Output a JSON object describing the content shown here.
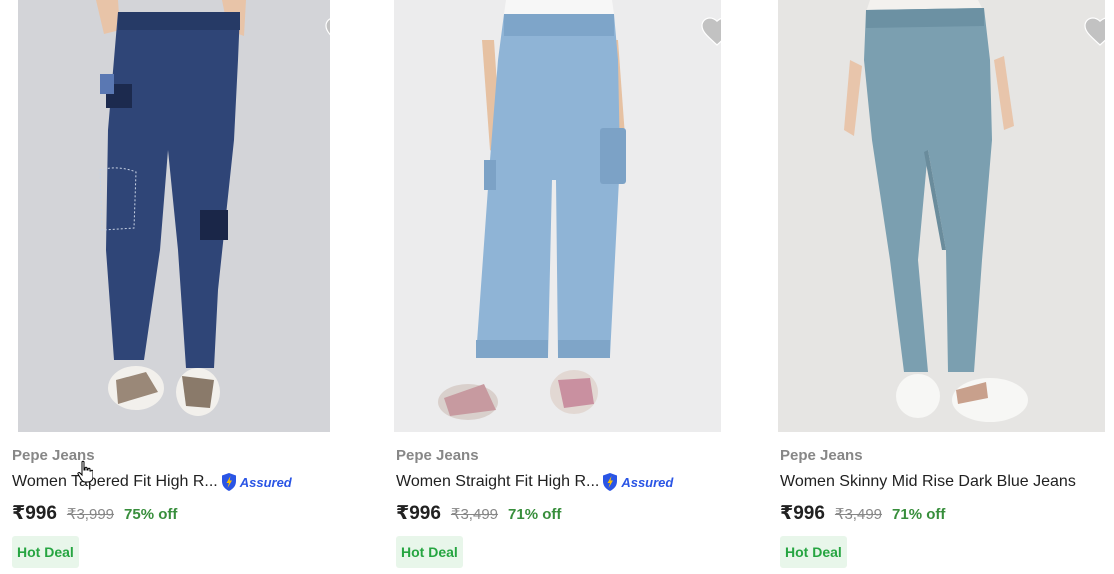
{
  "products": [
    {
      "brand": "Pepe Jeans",
      "title": "Women Tapered Fit High R...",
      "assured": true,
      "assured_label": "Assured",
      "price": "₹996",
      "mrp": "₹3,999",
      "discount": "75% off",
      "deal": "Hot Deal",
      "image_icon": "jeans-dark-blue-patched",
      "wishlisted": false
    },
    {
      "brand": "Pepe Jeans",
      "title": "Women Straight Fit High R...",
      "assured": true,
      "assured_label": "Assured",
      "price": "₹996",
      "mrp": "₹3,499",
      "discount": "71% off",
      "deal": "Hot Deal",
      "image_icon": "jeans-light-blue-cargo",
      "wishlisted": false
    },
    {
      "brand": "Pepe Jeans",
      "title": "Women Skinny Mid Rise Dark Blue Jeans",
      "assured": false,
      "price": "₹996",
      "mrp": "₹3,499",
      "discount": "71% off",
      "deal": "Hot Deal",
      "image_icon": "jeans-skinny-faded-blue",
      "wishlisted": false
    }
  ],
  "colors": {
    "price_green": "#388e3c",
    "deal_bg": "#e8f6ea",
    "deal_text": "#26a541",
    "assured_blue": "#2a55e5",
    "heart_gray": "#c2c2c2"
  }
}
